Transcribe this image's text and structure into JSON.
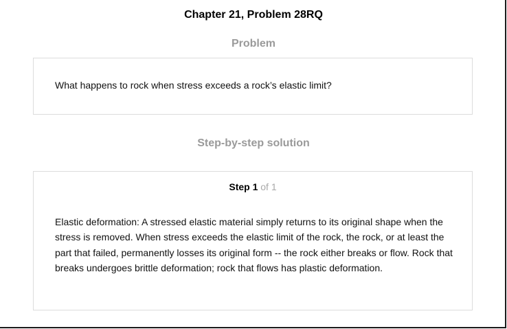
{
  "chapter_title": "Chapter 21, Problem 28RQ",
  "problem": {
    "heading": "Problem",
    "text": "What happens to rock when stress exceeds a rock’s elastic limit?"
  },
  "solution": {
    "heading": "Step-by-step solution",
    "step_label": "Step 1",
    "step_of": "of 1",
    "text": "Elastic deformation: A stressed elastic material simply returns to its original shape when the stress is removed. When stress exceeds the elastic limit of the rock, the rock, or at least the part that failed, permanently losses its original form -- the rock either breaks or flow. Rock that breaks undergoes brittle deformation; rock that flows has plastic deformation."
  },
  "colors": {
    "heading_gray": "#9a9a9a",
    "border_gray": "#dcdcdc",
    "step_of_gray": "#a8a8a8",
    "text": "#111111"
  }
}
